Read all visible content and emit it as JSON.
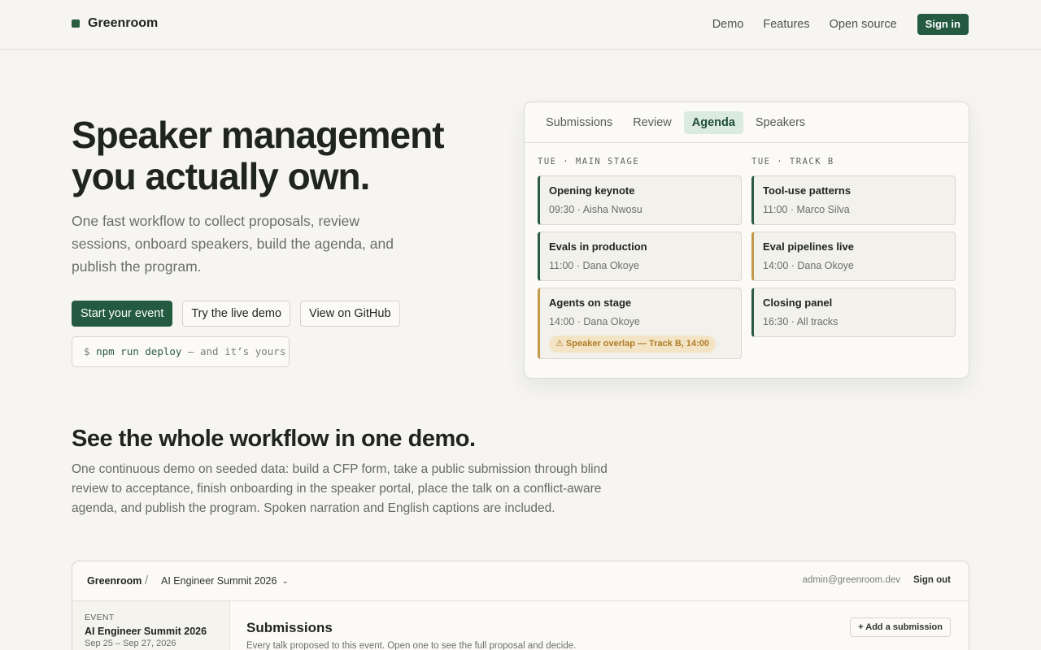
{
  "header": {
    "brand": "Greenroom",
    "nav": [
      "Demo",
      "Features",
      "Open source"
    ],
    "sign_in": "Sign in"
  },
  "hero": {
    "title": "Speaker management you actually own.",
    "subtitle": "One fast workflow to collect proposals, review sessions, onboard speakers, build the agenda, and publish the program.",
    "buttons": {
      "primary": "Start your event",
      "demo": "Try the live demo",
      "github": "View on GitHub"
    },
    "command": {
      "prompt": "$ ",
      "code": "npm run deploy",
      "suffix": " — and it’s yours"
    }
  },
  "preview": {
    "tabs": [
      "Submissions",
      "Review",
      "Agenda",
      "Speakers"
    ],
    "active_tab": "Agenda",
    "columns": [
      {
        "heading": "TUE · MAIN STAGE",
        "slots": [
          {
            "title": "Opening keynote",
            "meta": "09:30 · Aisha Nwosu"
          },
          {
            "title": "Evals in production",
            "meta": "11:00 · Dana Okoye"
          },
          {
            "title": "Agents on stage",
            "meta": "14:00 · Dana Okoye",
            "warning": "⚠ Speaker overlap — Track B, 14:00"
          }
        ]
      },
      {
        "heading": "TUE · TRACK B",
        "slots": [
          {
            "title": "Tool-use patterns",
            "meta": "11:00 · Marco Silva"
          },
          {
            "title": "Eval pipelines live",
            "meta": "14:00 · Dana Okoye"
          },
          {
            "title": "Closing panel",
            "meta": "16:30 · All tracks"
          }
        ]
      }
    ],
    "colors": {
      "accent": "#2a5c43",
      "warning_bar": "#c39a4a",
      "warning_bg": "#f3e4c5"
    }
  },
  "workflow": {
    "title": "See the whole workflow in one demo.",
    "text": "One continuous demo on seeded data: build a CFP form, take a public submission through blind review to acceptance, finish onboarding in the speaker portal, place the talk on a conflict-aware agenda, and publish the program. Spoken narration and English captions are included."
  },
  "demo_app": {
    "brand": "Greenroom",
    "separator": "/",
    "event_selector": "AI Engineer Summit 2026",
    "user": "admin@greenroom.dev",
    "sign_out": "Sign out",
    "sidebar": {
      "label": "EVENT",
      "event_name": "AI Engineer Summit 2026",
      "dates": "Sep 25 – Sep 27, 2026"
    },
    "main": {
      "title": "Submissions",
      "subtitle": "Every talk proposed to this event. Open one to see the full proposal and decide.",
      "add_button": "+ Add a submission"
    }
  }
}
